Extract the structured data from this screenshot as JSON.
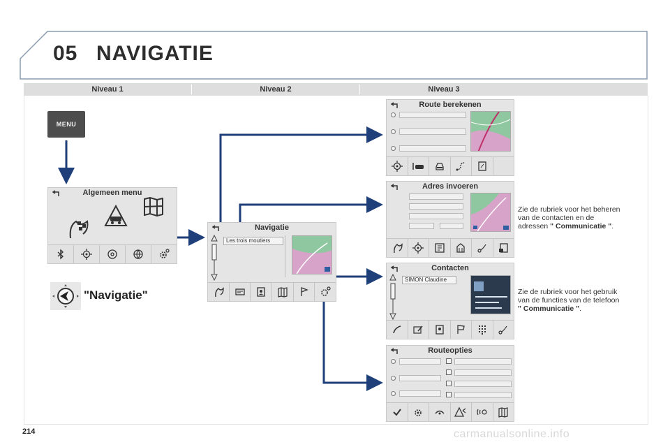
{
  "header": {
    "chapter": "05",
    "title": "NAVIGATIE"
  },
  "levels": [
    "Niveau 1",
    "Niveau 2",
    "Niveau 3"
  ],
  "menu_button": {
    "label": "MENU"
  },
  "general_menu": {
    "title": "Algemeen menu"
  },
  "navigation_label": "\"Navigatie\"",
  "navigation_screen": {
    "title": "Navigatie",
    "field_value": "Les trois moutiers"
  },
  "route_calc_screen": {
    "title": "Route berekenen"
  },
  "address_screen": {
    "title": "Adres invoeren"
  },
  "contacts_screen": {
    "title": "Contacten",
    "field_value": "SIMON Claudine"
  },
  "route_options_screen": {
    "title": "Routeopties"
  },
  "note_contacts": {
    "line1": "Zie de rubriek voor het beheren",
    "line2": "van de contacten en de",
    "line3_prefix": "adressen ",
    "line3_bold": "\" Communicatie \"",
    "line3_suffix": "."
  },
  "note_phone": {
    "line1": "Zie de rubriek voor het gebruik",
    "line2": "van de functies van de telefoon",
    "line3_bold": "\" Communicatie \"",
    "line3_suffix": "."
  },
  "page_number": "214",
  "watermark": "carmanualsonline.info",
  "colors": {
    "arrow": "#1f3f7a",
    "header_border": "#8a9bb0",
    "level_bar": "#dedede",
    "map_green": "#8fc7a0",
    "map_pink": "#d7a3c8"
  }
}
